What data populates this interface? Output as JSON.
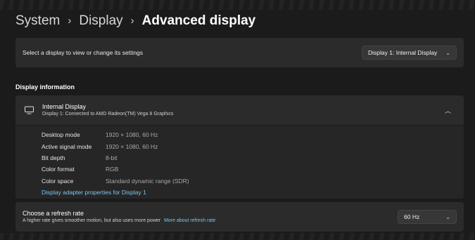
{
  "breadcrumb": {
    "items": [
      "System",
      "Display",
      "Advanced display"
    ],
    "separator": "›"
  },
  "display_selector": {
    "label": "Select a display to view or change its settings",
    "selected": "Display 1: Internal Display"
  },
  "display_information": {
    "section_title": "Display information",
    "name": "Internal Display",
    "connection": "Display 1: Connected to AMD Radeon(TM) Vega 8 Graphics",
    "rows": [
      {
        "key": "Desktop mode",
        "value": "1920 × 1080, 60 Hz"
      },
      {
        "key": "Active signal mode",
        "value": "1920 × 1080, 60 Hz"
      },
      {
        "key": "Bit depth",
        "value": "8-bit"
      },
      {
        "key": "Color format",
        "value": "RGB"
      },
      {
        "key": "Color space",
        "value": "Standard dynamic range (SDR)"
      }
    ],
    "adapter_link": "Display adapter properties for Display 1"
  },
  "refresh_rate": {
    "title": "Choose a refresh rate",
    "description": "A higher rate gives smoother motion, but also uses more power",
    "link": "More about refresh rate",
    "selected": "60 Hz"
  },
  "icons": {
    "breadcrumb_separator": "chevron-right-icon",
    "monitor": "monitor-icon",
    "dropdown": "chevron-down-icon",
    "collapse": "chevron-up-icon"
  },
  "colors": {
    "background": "#1b1b1b",
    "card": "#2b2b2b",
    "link": "#7fc4ef"
  }
}
